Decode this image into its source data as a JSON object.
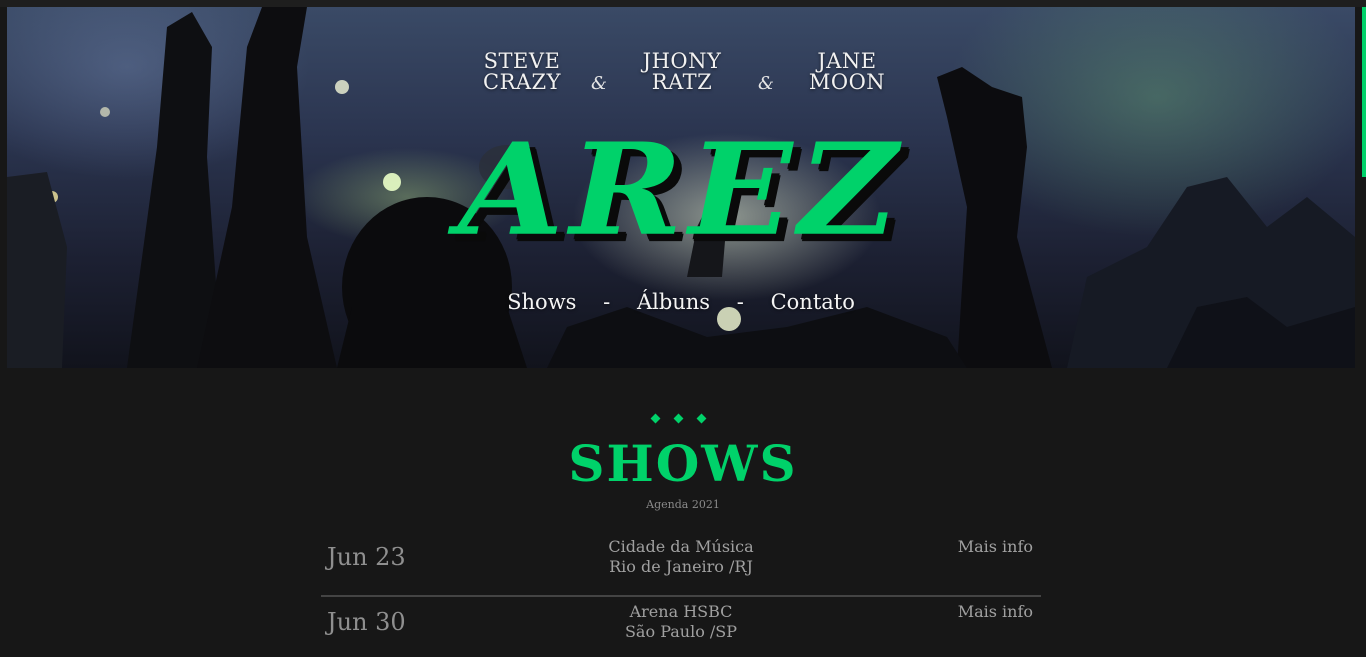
{
  "hero": {
    "members": [
      {
        "first": "STEVE",
        "last": "CRAZY"
      },
      {
        "first": "JHONY",
        "last": "RATZ"
      },
      {
        "first": "JANE",
        "last": "MOON"
      }
    ],
    "ampersand": "&",
    "logo": "AREZ",
    "nav": {
      "shows": "Shows",
      "albums": "Álbuns",
      "contact": "Contato",
      "separator": "-"
    }
  },
  "shows": {
    "title": "SHOWS",
    "subtitle": "Agenda 2021",
    "items": [
      {
        "date": "Jun 23",
        "venue": "Cidade da Música",
        "city": "Rio de Janeiro /RJ",
        "link": "Mais info"
      },
      {
        "date": "Jun 30",
        "venue": "Arena HSBC",
        "city": "São Paulo /SP",
        "link": "Mais info"
      }
    ]
  },
  "colors": {
    "accent": "#00d26a",
    "background": "#171717",
    "text_muted": "#9a9a9a"
  }
}
